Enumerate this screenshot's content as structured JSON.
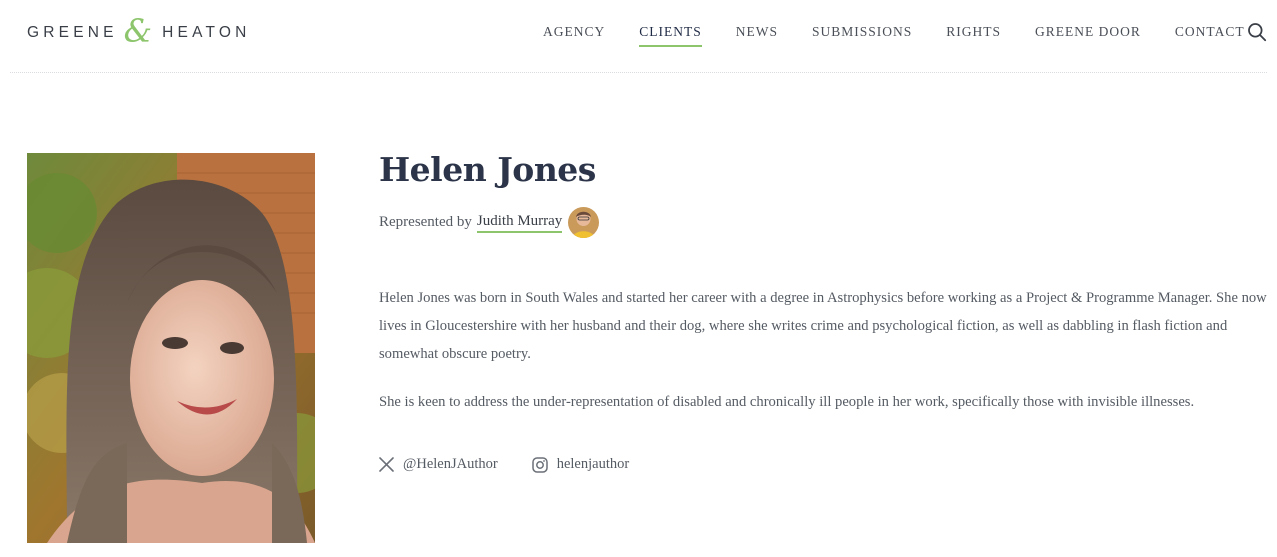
{
  "brand": {
    "left": "GREENE",
    "ampersand": "&",
    "right": "HEATON",
    "accent_color": "#8dc56c"
  },
  "nav": {
    "items": [
      {
        "label": "AGENCY"
      },
      {
        "label": "CLIENTS",
        "active": true
      },
      {
        "label": "NEWS"
      },
      {
        "label": "SUBMISSIONS"
      },
      {
        "label": "RIGHTS"
      },
      {
        "label": "GREENE DOOR"
      },
      {
        "label": "CONTACT"
      }
    ],
    "search_icon": "search-icon"
  },
  "client": {
    "name": "Helen Jones",
    "represented_by_label": "Represented by",
    "agent_name": "Judith Murray",
    "bio": [
      "Helen Jones was born in South Wales and started her career with a degree in Astrophysics before working as a Project & Programme Manager. She now lives in Gloucestershire with her husband and their dog, where she writes crime and psychological fiction, as well as dabbling in flash fiction and somewhat obscure poetry.",
      "She is keen to address the under-representation of disabled and chronically ill people in her work, specifically those with invisible illnesses."
    ],
    "social": {
      "x_handle": "@HelenJAuthor",
      "instagram_handle": "helenjauthor"
    }
  },
  "colors": {
    "heading": "#2b3448",
    "body_text": "#555b63",
    "accent": "#8dc56c"
  }
}
